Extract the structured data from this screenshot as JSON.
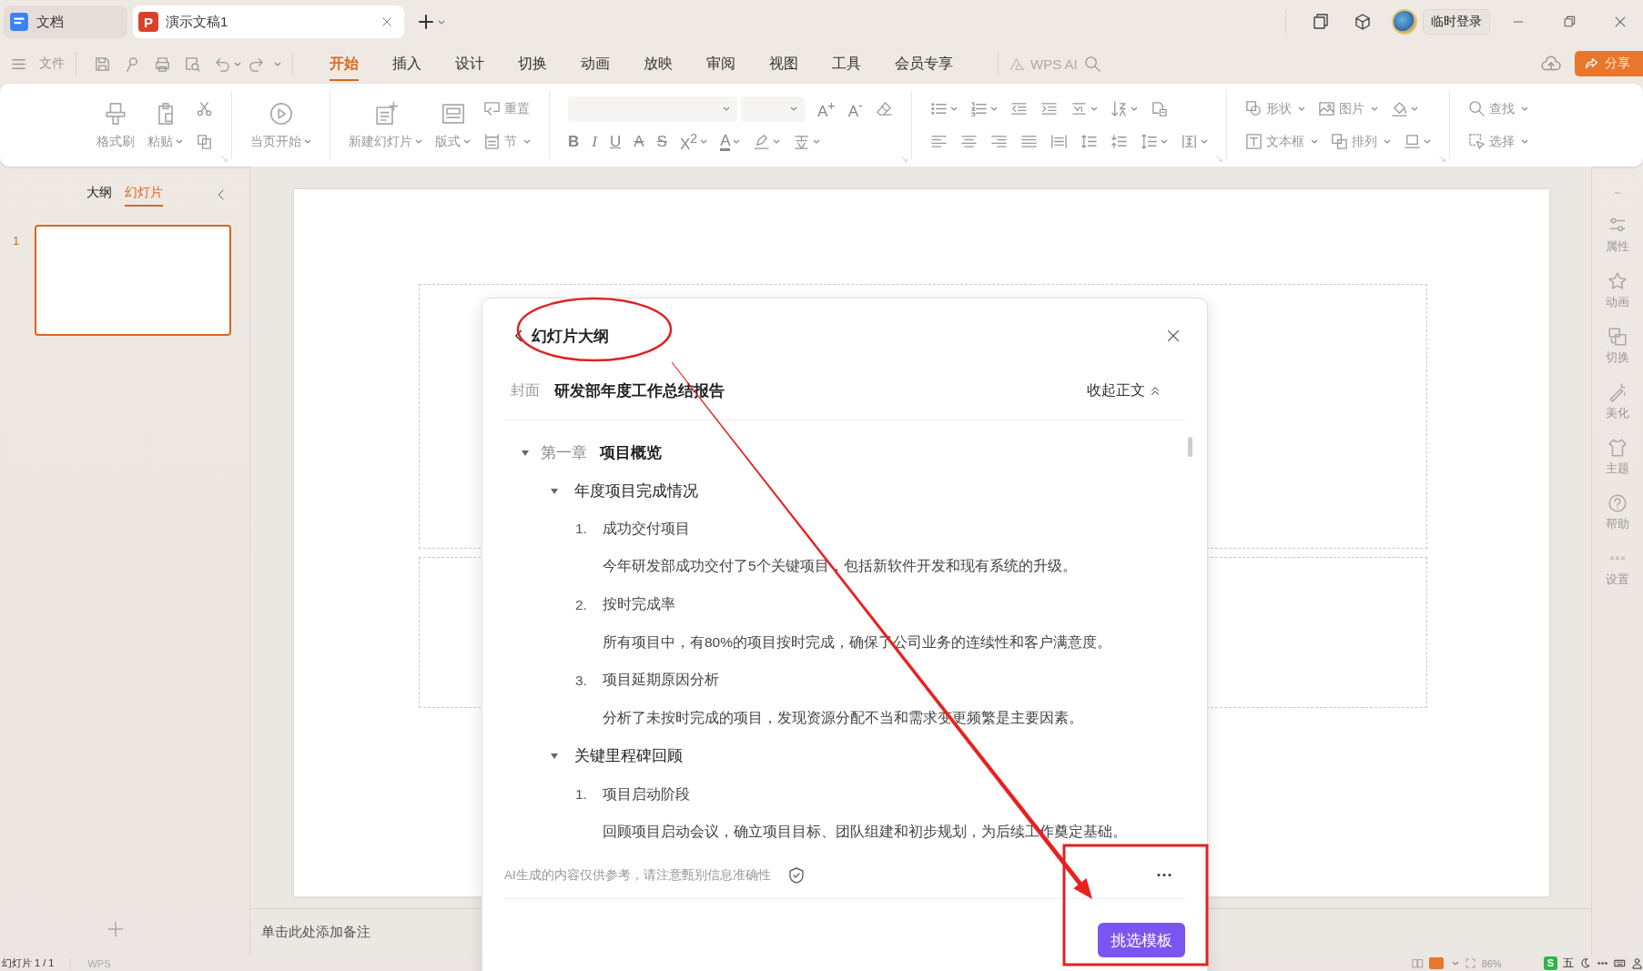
{
  "tabs": [
    {
      "label": "文档",
      "kind": "doc",
      "selected": false,
      "closable": false
    },
    {
      "label": "演示文稿1",
      "kind": "ppt",
      "logo": "P",
      "selected": true,
      "closable": true
    }
  ],
  "account": {
    "label": "临时登录"
  },
  "file_menu": {
    "label": "文件"
  },
  "menu_tabs": [
    {
      "label": "开始",
      "selected": true
    },
    {
      "label": "插入",
      "selected": false
    },
    {
      "label": "设计",
      "selected": false
    },
    {
      "label": "切换",
      "selected": false
    },
    {
      "label": "动画",
      "selected": false
    },
    {
      "label": "放映",
      "selected": false
    },
    {
      "label": "审阅",
      "selected": false
    },
    {
      "label": "视图",
      "selected": false
    },
    {
      "label": "工具",
      "selected": false
    },
    {
      "label": "会员专享",
      "selected": false
    }
  ],
  "ai": {
    "label": "WPS AI"
  },
  "share": {
    "label": "分享"
  },
  "ribbon": [
    {
      "launcher": true,
      "columns": [
        {
          "kind": "big",
          "label": "格式刷",
          "dropdown": false
        },
        {
          "kind": "big",
          "label": "粘贴",
          "dropdown": true
        },
        {
          "kind": "stack",
          "rows": [
            [
              {
                "kind": "icon",
                "dropdown": false
              }
            ],
            [
              {
                "kind": "icon",
                "dropdown": false
              }
            ]
          ]
        }
      ]
    },
    {
      "launcher": false,
      "columns": [
        {
          "kind": "big",
          "label": "当页开始",
          "dropdown": true
        }
      ]
    },
    {
      "launcher": false,
      "columns": [
        {
          "kind": "big",
          "label": "新建幻灯片",
          "dropdown": true
        },
        {
          "kind": "big",
          "label": "版式",
          "dropdown": true
        },
        {
          "kind": "stack",
          "rows": [
            [
              {
                "kind": "labeled",
                "label": "重置",
                "dropdown": false
              }
            ],
            [
              {
                "kind": "labeled",
                "label": "节",
                "dropdown": true
              }
            ]
          ]
        }
      ]
    },
    {
      "launcher": true,
      "columns": [
        {
          "kind": "stack",
          "rows": [
            [
              {
                "kind": "fontbox",
                "dropdown": true
              },
              {
                "kind": "sizebox",
                "dropdown": true
              },
              {
                "kind": "glyph",
                "label": "A$^{+}$",
                "dropdown": false
              },
              {
                "kind": "glyph",
                "label": "A$^{-}$",
                "dropdown": false
              },
              {
                "kind": "icon",
                "dropdown": false
              }
            ],
            [
              {
                "kind": "bold",
                "label": "B",
                "dropdown": false
              },
              {
                "kind": "italic",
                "label": "I",
                "dropdown": false
              },
              {
                "kind": "underline",
                "label": "U",
                "dropdown": false
              },
              {
                "kind": "strike",
                "label": "A",
                "dropdown": false
              },
              {
                "kind": "strike",
                "label": "S",
                "dropdown": false
              },
              {
                "kind": "glyph",
                "label": "X$^{2}$",
                "dropdown": true
              },
              {
                "kind": "colorbar",
                "label": "A",
                "dropdown": true
              },
              {
                "kind": "icon",
                "dropdown": true
              },
              {
                "kind": "icon",
                "dropdown": true
              }
            ]
          ]
        }
      ]
    },
    {
      "launcher": true,
      "columns": [
        {
          "kind": "stack",
          "rows": [
            [
              {
                "kind": "icon",
                "dropdown": true
              },
              {
                "kind": "icon",
                "dropdown": true
              },
              {
                "kind": "icon",
                "dropdown": false
              },
              {
                "kind": "icon",
                "dropdown": false
              },
              {
                "kind": "icon",
                "dropdown": true
              },
              {
                "kind": "icon",
                "dropdown": true
              },
              {
                "kind": "icon",
                "dropdown": false
              }
            ],
            [
              {
                "kind": "icon",
                "dropdown": false
              },
              {
                "kind": "icon",
                "dropdown": false
              },
              {
                "kind": "icon",
                "dropdown": false
              },
              {
                "kind": "icon",
                "dropdown": false
              },
              {
                "kind": "icon",
                "dropdown": false
              },
              {
                "kind": "icon",
                "dropdown": false
              },
              {
                "kind": "icon",
                "dropdown": false
              },
              {
                "kind": "icon",
                "dropdown": true
              },
              {
                "kind": "icon",
                "dropdown": true
              }
            ]
          ]
        }
      ]
    },
    {
      "launcher": true,
      "columns": [
        {
          "kind": "stack",
          "rows": [
            [
              {
                "kind": "labeled",
                "label": "形状",
                "dropdown": true
              },
              {
                "kind": "labeled",
                "label": "图片",
                "dropdown": true
              },
              {
                "kind": "icon",
                "dropdown": true
              }
            ],
            [
              {
                "kind": "labeled",
                "label": "文本框",
                "dropdown": true
              },
              {
                "kind": "labeled",
                "label": "排列",
                "dropdown": true
              },
              {
                "kind": "icon",
                "dropdown": true
              }
            ]
          ]
        }
      ]
    },
    {
      "launcher": false,
      "columns": [
        {
          "kind": "stack",
          "rows": [
            [
              {
                "kind": "labeled",
                "label": "查找",
                "dropdown": true
              }
            ],
            [
              {
                "kind": "labeled",
                "label": "选择",
                "dropdown": true
              }
            ]
          ]
        }
      ]
    }
  ],
  "left_panel": {
    "tabs": [
      {
        "label": "大纲",
        "selected": false
      },
      {
        "label": "幻灯片",
        "selected": true
      }
    ],
    "slides": [
      {
        "number": "1",
        "selected": true
      }
    ]
  },
  "notes": {
    "placeholder": "单击此处添加备注"
  },
  "right_sidebar": [
    {
      "label": "属性"
    },
    {
      "label": "动画"
    },
    {
      "label": "切换"
    },
    {
      "label": "美化"
    },
    {
      "label": "主题"
    },
    {
      "label": "帮助"
    },
    {
      "label": "设置"
    }
  ],
  "dialog": {
    "title": "幻灯片大纲",
    "cover": {
      "label": "封面",
      "title": "研发部年度工作总结报告"
    },
    "toggle": {
      "label": "收起正文"
    },
    "outline": [
      {
        "prefix": "第一章",
        "title": "项目概览",
        "expanded": true,
        "children": [
          {
            "title": "年度项目完成情况",
            "expanded": true,
            "children": [
              {
                "number": "1.",
                "title": "成功交付项目",
                "body": "今年研发部成功交付了5个关键项目，包括新软件开发和现有系统的升级。"
              },
              {
                "number": "2.",
                "title": "按时完成率",
                "body": "所有项目中，有80%的项目按时完成，确保了公司业务的连续性和客户满意度。"
              },
              {
                "number": "3.",
                "title": "项目延期原因分析",
                "body": "分析了未按时完成的项目，发现资源分配不当和需求变更频繁是主要因素。"
              }
            ]
          },
          {
            "title": "关键里程碑回顾",
            "expanded": true,
            "children": [
              {
                "number": "1.",
                "title": "项目启动阶段",
                "body": "回顾项目启动会议，确立项目目标、团队组建和初步规划，为后续工作奠定基础。"
              }
            ]
          }
        ]
      }
    ],
    "disclaimer": "AI生成的内容仅供参考，请注意甄别信息准确性",
    "button": {
      "label": "挑选模板"
    }
  },
  "status_bar": {
    "slide_count": "幻灯片 1 / 1",
    "theme": "WPS",
    "zoom": "86%"
  },
  "ime": {
    "logo": "S",
    "mode": "五"
  }
}
